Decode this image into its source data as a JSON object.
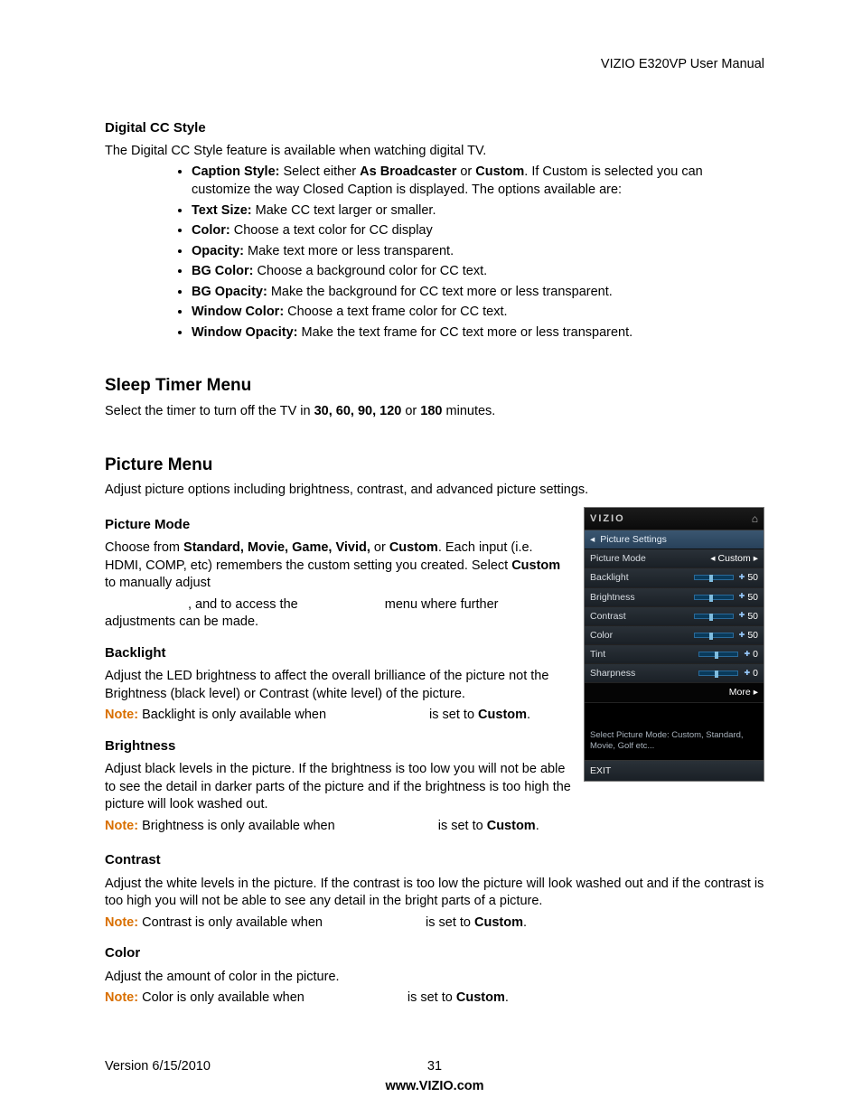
{
  "header": {
    "manual_title": "VIZIO E320VP User Manual"
  },
  "digital_cc": {
    "heading": "Digital CC Style",
    "intro": "The Digital CC Style feature is available when watching digital TV.",
    "caption_style_label": "Caption Style:",
    "caption_style_text_a": " Select either ",
    "caption_style_bold_a": "As Broadcaster",
    "caption_style_text_b": " or ",
    "caption_style_bold_b": "Custom",
    "caption_style_text_c": ". If Custom is selected you can customize the way Closed Caption is displayed. The options available are:",
    "bullets": [
      {
        "label": "Text Size:",
        "text": " Make CC text larger or smaller."
      },
      {
        "label": "Color:",
        "text": " Choose a text color for CC display"
      },
      {
        "label": "Opacity:",
        "text": " Make text more or less transparent."
      },
      {
        "label": "BG Color:",
        "text": " Choose a background color for CC text."
      },
      {
        "label": "BG Opacity:",
        "text": " Make the background for CC text more or less transparent."
      },
      {
        "label": "Window Color:",
        "text": " Choose a text frame color for CC text."
      },
      {
        "label": "Window Opacity:",
        "text": " Make the text frame for CC text more or less transparent."
      }
    ]
  },
  "sleep_timer": {
    "heading": "Sleep Timer Menu",
    "text_a": "Select the timer to turn off the TV in ",
    "bold_a": "30, 60, 90, 120",
    "text_b": " or ",
    "bold_b": "180",
    "text_c": " minutes."
  },
  "picture_menu": {
    "heading": "Picture Menu",
    "intro": "Adjust picture options including brightness, contrast, and advanced picture settings.",
    "mode": {
      "heading": "Picture Mode",
      "text_a": "Choose from ",
      "bold_a": "Standard, Movie, Game, Vivid,",
      "text_b": " or ",
      "bold_b": "Custom",
      "text_c": ". Each input (i.e. HDMI, COMP, etc) remembers the custom setting you created. Select ",
      "bold_c": "Custom",
      "text_d": " to manually adjust",
      "line2_a": ", and to access the ",
      "line2_b": "menu where further adjustments can be made."
    },
    "backlight": {
      "heading": "Backlight",
      "body": "Adjust the LED brightness to affect the overall brilliance of the picture not the Brightness (black level) or Contrast (white level) of the picture.",
      "note_label": "Note:",
      "note_a": " Backlight is only available when ",
      "note_b": "is set to ",
      "note_bold": "Custom",
      "note_c": "."
    },
    "brightness": {
      "heading": "Brightness",
      "body": "Adjust black levels in the picture. If the brightness is too low you will not be able to see the detail in darker parts of the picture and if the brightness is too high the picture will look washed out.",
      "note_label": "Note:",
      "note_a": " Brightness is only available when ",
      "note_b": "is set to ",
      "note_bold": "Custom",
      "note_c": "."
    },
    "contrast": {
      "heading": "Contrast",
      "body": "Adjust the white levels in the picture. If the contrast is too low the picture will look washed out and if the contrast is too high you will not be able to see any detail in the bright parts of a picture.",
      "note_label": "Note:",
      "note_a": " Contrast is only available when ",
      "note_b": "is set to ",
      "note_bold": "Custom",
      "note_c": "."
    },
    "color": {
      "heading": "Color",
      "body": "Adjust the amount of color in the picture.",
      "note_label": "Note:",
      "note_a": " Color is only available when ",
      "note_b": "is set to ",
      "note_bold": "Custom",
      "note_c": "."
    }
  },
  "osd": {
    "brand": "VIZIO",
    "subtitle": "Picture Settings",
    "rows": [
      {
        "label": "Picture Mode",
        "value": "Custom",
        "arrows": true
      },
      {
        "label": "Backlight",
        "value": "50",
        "slider": 50
      },
      {
        "label": "Brightness",
        "value": "50",
        "slider": 50
      },
      {
        "label": "Contrast",
        "value": "50",
        "slider": 50
      },
      {
        "label": "Color",
        "value": "50",
        "slider": 50
      },
      {
        "label": "Tint",
        "value": "0",
        "slider": 50
      },
      {
        "label": "Sharpness",
        "value": "0",
        "slider": 50
      }
    ],
    "more": "More",
    "hint": "Select Picture Mode: Custom, Standard, Movie, Golf etc...",
    "exit": "EXIT"
  },
  "footer": {
    "version": "Version 6/15/2010",
    "page": "31",
    "url": "www.VIZIO.com"
  }
}
